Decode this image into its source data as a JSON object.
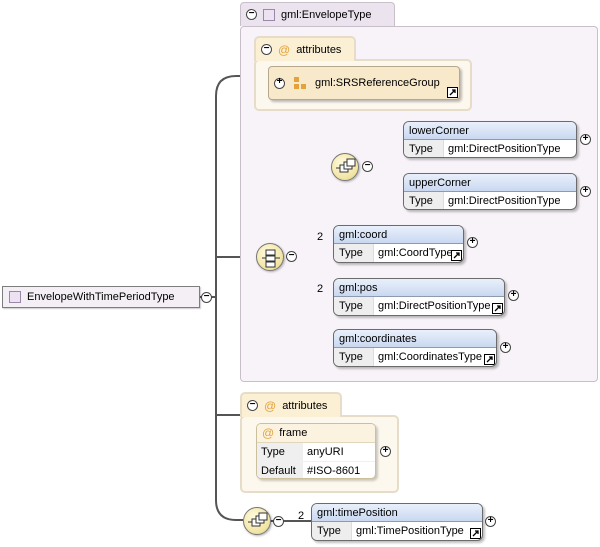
{
  "root": {
    "label": "EnvelopeWithTimePeriodType"
  },
  "base_type": {
    "label": "gml:EnvelopeType"
  },
  "attributes_label": "attributes",
  "attribute_group": {
    "label": "gml:SRSReferenceGroup"
  },
  "elements": {
    "lower_corner": {
      "name": "lowerCorner",
      "type_key": "Type",
      "type": "gml:DirectPositionType"
    },
    "upper_corner": {
      "name": "upperCorner",
      "type_key": "Type",
      "type": "gml:DirectPositionType"
    },
    "coord": {
      "name": "gml:coord",
      "occurrence": "2",
      "type_key": "Type",
      "type": "gml:CoordType"
    },
    "pos": {
      "name": "gml:pos",
      "occurrence": "2",
      "type_key": "Type",
      "type": "gml:DirectPositionType"
    },
    "coordinates": {
      "name": "gml:coordinates",
      "type_key": "Type",
      "type": "gml:CoordinatesType"
    },
    "time_position": {
      "name": "gml:timePosition",
      "occurrence": "2",
      "type_key": "Type",
      "type": "gml:TimePositionType"
    }
  },
  "frame_attribute": {
    "name": "frame",
    "type_key": "Type",
    "type": "anyURI",
    "default_key": "Default",
    "default": "#ISO-8601"
  },
  "symbols": {
    "expand": "+",
    "collapse": "−",
    "at": "@"
  },
  "colors": {
    "element_header": "#c9d8f0",
    "attribute_panel": "#fdf8ee",
    "type_panel": "#f7f3f8",
    "compositor": "#f1e3a0"
  }
}
